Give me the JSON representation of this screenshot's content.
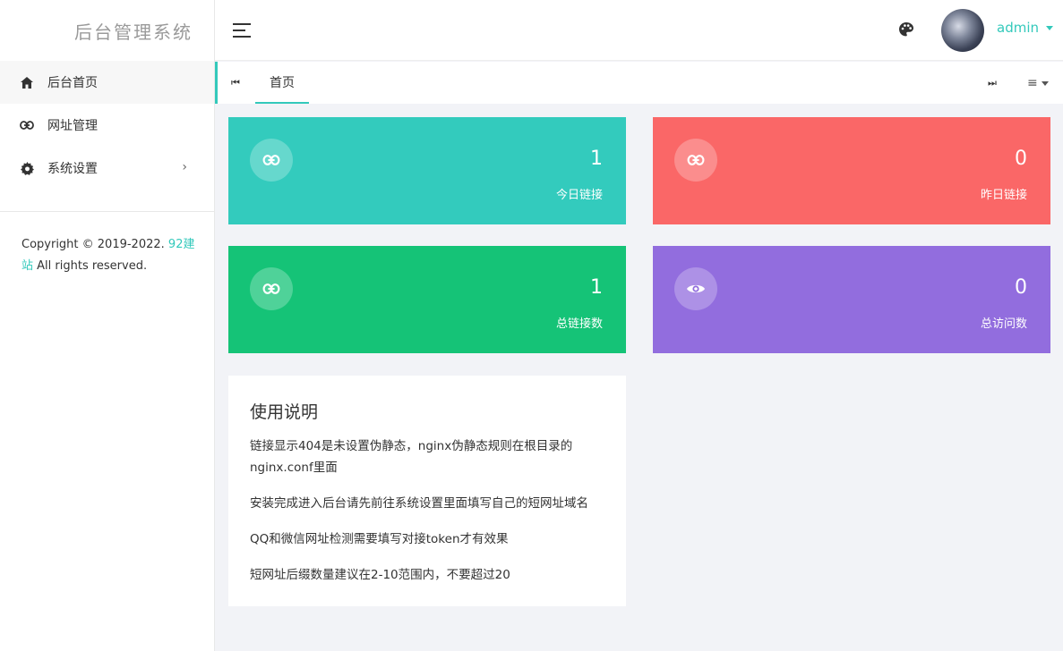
{
  "sidebar": {
    "brand": "后台管理系统",
    "items": [
      {
        "label": "后台首页",
        "icon": "home-icon"
      },
      {
        "label": "网址管理",
        "icon": "link-icon"
      },
      {
        "label": "系统设置",
        "icon": "gear-icon",
        "chevron": "›"
      }
    ],
    "copyright": {
      "prefix": "Copyright © 2019-2022. ",
      "link": "92建站",
      "suffix": " All rights reserved."
    }
  },
  "header": {
    "menu_icon": "hamburger-icon",
    "theme_icon": "palette-icon",
    "username": "admin"
  },
  "tabs": {
    "prev_icon": "⏮",
    "next_icon": "⏭",
    "home": "首页",
    "menu_icon": "≡"
  },
  "stats": [
    {
      "value": "1",
      "label": "今日链接",
      "color": "#33cbbd",
      "icon": "link-icon"
    },
    {
      "value": "0",
      "label": "昨日链接",
      "color": "#fa6767",
      "icon": "link-icon"
    },
    {
      "value": "1",
      "label": "总链接数",
      "color": "#15c377",
      "icon": "link-icon"
    },
    {
      "value": "0",
      "label": "总访问数",
      "color": "#926dde",
      "icon": "eye-icon"
    }
  ],
  "usage": {
    "title": "使用说明",
    "lines": [
      "链接显示404是未设置伪静态，nginx伪静态规则在根目录的nginx.conf里面",
      "安装完成进入后台请先前往系统设置里面填写自己的短网址域名",
      "QQ和微信网址检测需要填写对接token才有效果",
      "短网址后缀数量建议在2-10范围内，不要超过20"
    ]
  }
}
